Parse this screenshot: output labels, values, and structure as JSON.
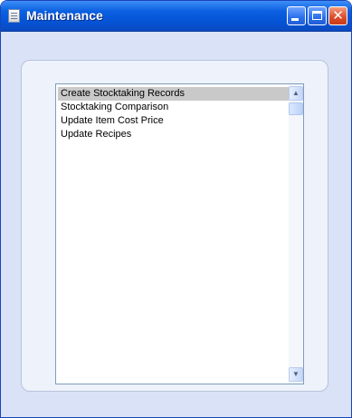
{
  "window": {
    "title": "Maintenance",
    "icon": "document-icon",
    "buttons": {
      "minimize": "minimize-icon",
      "maximize": "maximize-icon",
      "close": "close-icon"
    }
  },
  "list": {
    "selected_index": 0,
    "items": [
      {
        "label": "Create Stocktaking Records",
        "selected": true
      },
      {
        "label": "Stocktaking Comparison",
        "selected": false
      },
      {
        "label": "Update Item Cost Price",
        "selected": false
      },
      {
        "label": "Update Recipes",
        "selected": false
      }
    ]
  },
  "colors": {
    "titlebar": "#0553d6",
    "window_bg": "#d9e2f7",
    "selection": "#c9c9c9",
    "close_button": "#dd4b27"
  }
}
